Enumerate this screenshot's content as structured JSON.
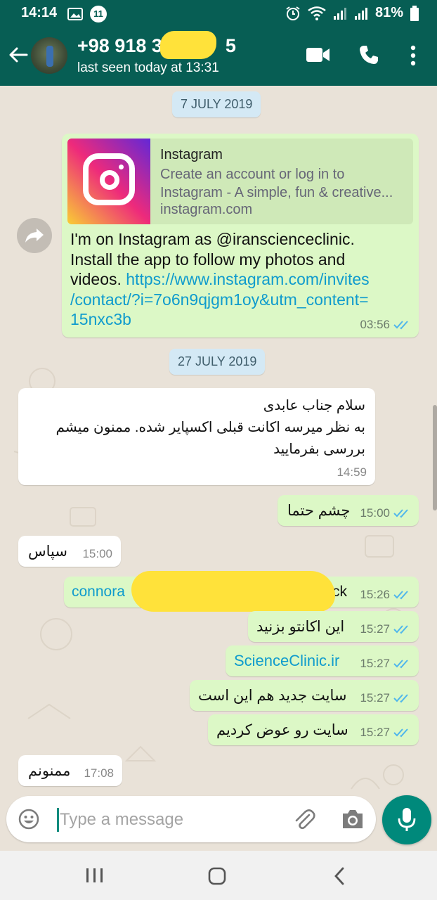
{
  "status_bar": {
    "time": "14:14",
    "notification_count": "11",
    "battery": "81%"
  },
  "header": {
    "contact_name": "+98 918 3█ █5",
    "contact_name_left": "+98 918 3",
    "contact_name_right": "5",
    "last_seen": "last seen today at 13:31"
  },
  "chat": {
    "dates": [
      "7 JULY 2019",
      "27 JULY 2019"
    ],
    "link_preview": {
      "title": "Instagram",
      "description_line1": "Create an account or log in to",
      "description_line2": "Instagram - A simple, fun & creative...",
      "domain": "instagram.com"
    },
    "instagram_message": {
      "text_line1": "I'm on Instagram as @iranscienceclinic.",
      "text_line2": "Install the app to follow my photos and",
      "text_line3_plain": "videos. ",
      "url_line1": "https://www.instagram.com/invites",
      "url_line2": "/contact/?i=7o6n9qjgm1oy&utm_content=",
      "url_line3": "15nxc3b",
      "time": "03:56"
    },
    "messages": [
      {
        "direction": "in",
        "line1": "سلام جناب عابدی",
        "line2": "به نظر میرسه اکانت قبلی اکسپایر شده. ممنون میشم",
        "line3": "بررسی بفرمایید",
        "time": "14:59"
      },
      {
        "direction": "out",
        "text": "چشم حتما",
        "time": "15:00"
      },
      {
        "direction": "in",
        "text": "سپاس",
        "time": "15:00"
      },
      {
        "direction": "out",
        "text_left": "connora",
        "text_right": "ck",
        "time": "15:26"
      },
      {
        "direction": "out",
        "text": "این اکانتو بزنید",
        "time": "15:27"
      },
      {
        "direction": "out",
        "text": "ScienceClinic.ir",
        "time": "15:27"
      },
      {
        "direction": "out",
        "text": "سایت جدید هم این است",
        "time": "15:27"
      },
      {
        "direction": "out",
        "text": "سایت رو عوض کردیم",
        "time": "15:27"
      },
      {
        "direction": "in",
        "text": "ممنونم",
        "time": "17:08"
      }
    ]
  },
  "composer": {
    "placeholder": "Type a message"
  },
  "colors": {
    "header": "#075e54",
    "outgoing_bubble": "#dcf8c6",
    "incoming_bubble": "#ffffff",
    "chat_background": "#e9e2d8",
    "link": "#0f9bcd",
    "read_ticks": "#4fb6ec",
    "mic_button": "#00897b"
  },
  "icons": [
    "back-arrow-icon",
    "video-call-icon",
    "voice-call-icon",
    "more-options-icon",
    "forward-icon",
    "read-receipt-icon",
    "emoji-icon",
    "attach-icon",
    "camera-icon",
    "mic-icon",
    "recents-nav-icon",
    "home-nav-icon",
    "back-nav-icon"
  ]
}
